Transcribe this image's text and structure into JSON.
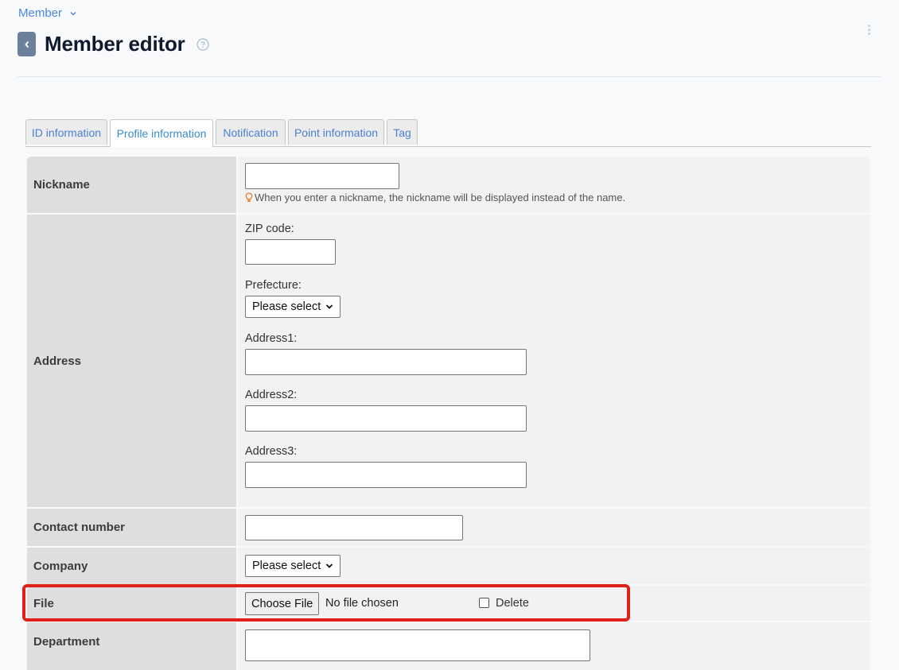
{
  "breadcrumb": {
    "label": "Member"
  },
  "header": {
    "title": "Member editor"
  },
  "tabs": [
    {
      "label": "ID information",
      "active": false
    },
    {
      "label": "Profile information",
      "active": true
    },
    {
      "label": "Notification",
      "active": false
    },
    {
      "label": "Point information",
      "active": false
    },
    {
      "label": "Tag",
      "active": false
    }
  ],
  "form": {
    "nickname": {
      "label": "Nickname",
      "value": "",
      "hint": "When you enter a nickname, the nickname will be displayed instead of the name."
    },
    "address": {
      "label": "Address",
      "zip_label": "ZIP code:",
      "zip_value": "",
      "prefecture_label": "Prefecture:",
      "prefecture_value": "Please select",
      "address1_label": "Address1:",
      "address2_label": "Address2:",
      "address3_label": "Address3:"
    },
    "contact": {
      "label": "Contact number",
      "value": ""
    },
    "company": {
      "label": "Company",
      "value": "Please select"
    },
    "file": {
      "label": "File",
      "button": "Choose File",
      "status": "No file chosen",
      "delete_label": "Delete",
      "delete_checked": false
    },
    "department": {
      "label": "Department",
      "value": ""
    }
  },
  "colors": {
    "accent": "#4a86e8",
    "highlight": "#e0201a",
    "hint_icon": "#f07a2a"
  }
}
